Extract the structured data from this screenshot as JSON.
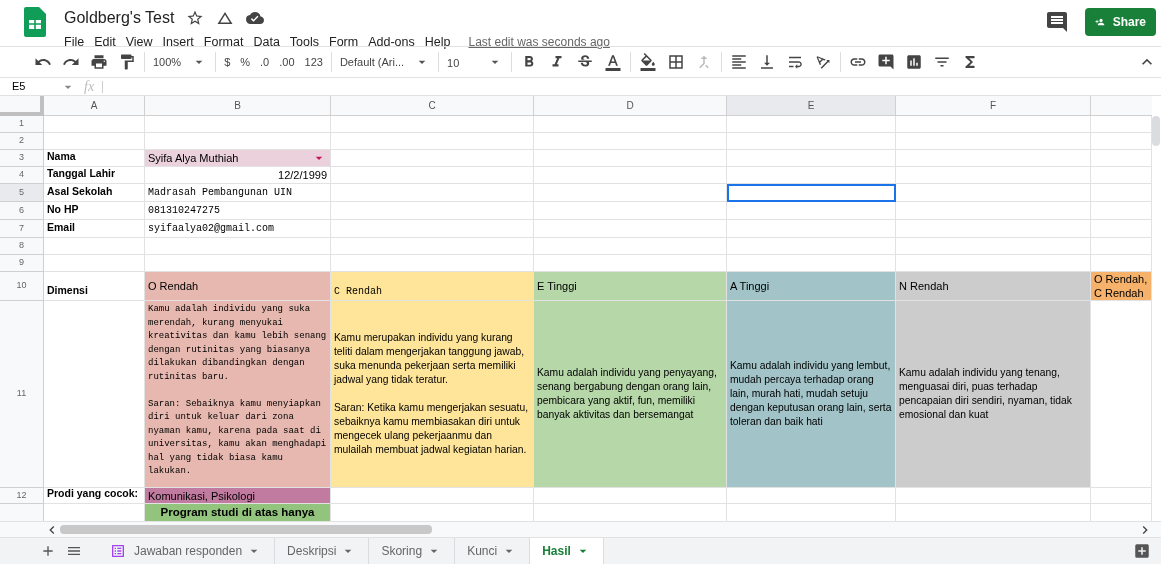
{
  "document": {
    "title": "Goldberg's Test",
    "last_edit": "Last edit was seconds ago"
  },
  "menu": [
    "File",
    "Edit",
    "View",
    "Insert",
    "Format",
    "Data",
    "Tools",
    "Form",
    "Add-ons",
    "Help"
  ],
  "share_button": "Share",
  "toolbar": {
    "zoom": "100%",
    "currency": "$",
    "percent": "%",
    "decrease_decimal": ".0",
    "increase_decimal": ".00",
    "number_format": "123",
    "font": "Default (Ari...",
    "font_size": "10"
  },
  "formula_bar": {
    "cell_reference": "E5",
    "function_label": "fx"
  },
  "columns": [
    {
      "label": "A",
      "selected": false
    },
    {
      "label": "B",
      "selected": false
    },
    {
      "label": "C",
      "selected": false
    },
    {
      "label": "D",
      "selected": false
    },
    {
      "label": "E",
      "selected": true
    },
    {
      "label": "F",
      "selected": false
    }
  ],
  "rows": [
    {
      "number": "1",
      "selected": false,
      "cells": [
        null,
        null,
        null,
        null,
        null,
        null,
        null
      ]
    },
    {
      "number": "2",
      "selected": false,
      "cells": [
        null,
        null,
        null,
        null,
        null,
        null,
        null
      ]
    },
    {
      "number": "3",
      "selected": false,
      "cells": [
        {
          "kind": "label",
          "text": "Nama"
        },
        {
          "kind": "dropdown",
          "text": "Syifa Alya Muthiah",
          "color": "#ead1dc"
        },
        null,
        null,
        null,
        null,
        null
      ]
    },
    {
      "number": "4",
      "selected": false,
      "cells": [
        {
          "kind": "label",
          "text": "Tanggal Lahir"
        },
        {
          "kind": "date",
          "text": "12/2/1999"
        },
        null,
        null,
        null,
        null,
        null
      ]
    },
    {
      "number": "5",
      "selected": true,
      "cells": [
        {
          "kind": "label",
          "text": "Asal Sekolah"
        },
        {
          "kind": "mono",
          "text": "Madrasah Pembangunan UIN"
        },
        null,
        null,
        null,
        null,
        null
      ]
    },
    {
      "number": "6",
      "selected": false,
      "cells": [
        {
          "kind": "label",
          "text": "No HP"
        },
        {
          "kind": "mono",
          "text": "081310247275"
        },
        null,
        null,
        null,
        null,
        null
      ]
    },
    {
      "number": "7",
      "selected": false,
      "cells": [
        {
          "kind": "label",
          "text": "Email"
        },
        {
          "kind": "mono",
          "text": "syifaalya02@gmail.com"
        },
        null,
        null,
        null,
        null,
        null
      ]
    },
    {
      "number": "8",
      "selected": false,
      "cells": [
        null,
        null,
        null,
        null,
        null,
        null,
        null
      ]
    },
    {
      "number": "9",
      "selected": false,
      "cells": [
        null,
        null,
        null,
        null,
        null,
        null,
        null
      ]
    },
    {
      "number": "10",
      "selected": false,
      "cells": [
        {
          "kind": "label",
          "text": "Dimensi"
        },
        {
          "kind": "text",
          "text": "O Rendah",
          "color": "#e6b8af"
        },
        {
          "kind": "mono",
          "text": "C Rendah",
          "color": "#ffe599"
        },
        {
          "kind": "text",
          "text": "E Tinggi",
          "color": "#b6d7a8"
        },
        {
          "kind": "text",
          "text": "A Tinggi",
          "color": "#a2c4c9"
        },
        {
          "kind": "text",
          "text": "N Rendah",
          "color": "#cccccc"
        },
        {
          "kind": "text",
          "text": "O Rendah, C Rendah",
          "color": "#f6b26b"
        }
      ]
    },
    {
      "number": "11",
      "selected": false,
      "cells": [
        null,
        {
          "kind": "mono",
          "text": "Kamu adalah individu yang suka merendah, kurang menyukai kreativitas dan kamu lebih senang dengan rutinitas yang biasanya dilakukan dibandingkan dengan rutinitas baru.\n\nSaran: Sebaiknya kamu menyiapkan diri untuk keluar dari zona nyaman kamu, karena pada saat di universitas, kamu akan menghadapi hal yang tidak biasa kamu lakukan.",
          "color": "#e6b8af"
        },
        {
          "kind": "text",
          "text": "Kamu merupakan individu yang kurang teliti dalam mengerjakan tanggung jawab, suka menunda pekerjaan serta memiliki jadwal yang tidak teratur.\n\nSaran: Ketika kamu mengerjakan sesuatu, sebaiknya kamu membiasakan diri untuk mengecek ulang pekerjaanmu dan mulailah membuat jadwal kegiatan harian.",
          "color": "#ffe599"
        },
        {
          "kind": "text",
          "text": "Kamu adalah individu yang penyayang, senang bergabung dengan orang lain, pembicara yang aktif, fun, memiliki banyak aktivitas dan bersemangat",
          "color": "#b6d7a8"
        },
        {
          "kind": "text",
          "text": "Kamu adalah individu yang lembut, mudah percaya terhadap orang lain, murah hati, mudah setuju dengan keputusan orang lain, serta toleran dan baik hati",
          "color": "#a2c4c9"
        },
        {
          "kind": "text",
          "text": "Kamu adalah individu yang tenang, menguasai diri, puas terhadap pencapaian diri sendiri, nyaman, tidak emosional dan kuat",
          "color": "#cccccc"
        },
        null
      ]
    },
    {
      "number": "12",
      "selected": false,
      "cells": [
        {
          "kind": "label",
          "text": "Prodi yang cocok:"
        },
        {
          "kind": "text",
          "text": "Komunikasi, Psikologi",
          "color": "#c27ba0"
        },
        null,
        null,
        null,
        null,
        null
      ]
    },
    {
      "number": "",
      "selected": false,
      "cells": [
        null,
        {
          "kind": "note",
          "text": "Program studi di atas hanya",
          "color": "#93c47d"
        },
        null,
        null,
        null,
        null,
        null
      ]
    }
  ],
  "sheet_tabs": [
    {
      "label": "Jawaban responden",
      "kind": "form",
      "selected": false
    },
    {
      "label": "Deskripsi",
      "kind": "sheet",
      "selected": false
    },
    {
      "label": "Skoring",
      "kind": "sheet",
      "selected": false
    },
    {
      "label": "Kunci",
      "kind": "sheet",
      "selected": false
    },
    {
      "label": "Hasil",
      "kind": "sheet",
      "selected": true
    }
  ]
}
